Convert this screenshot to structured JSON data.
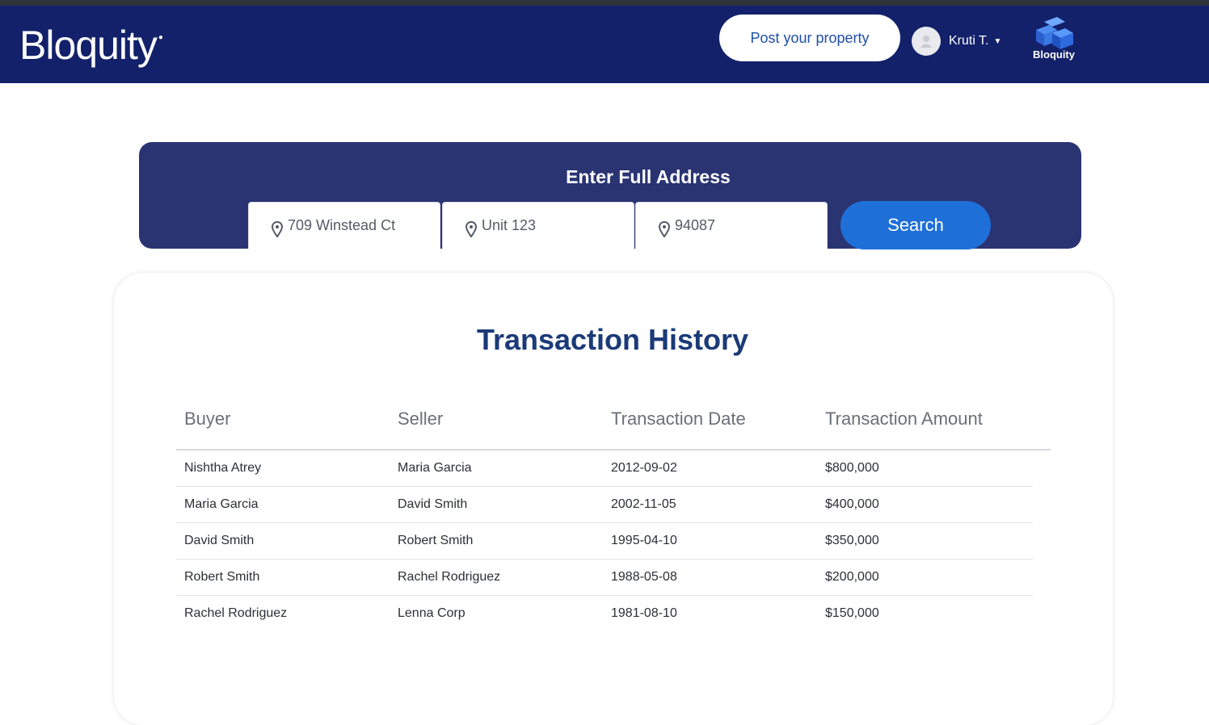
{
  "app": {
    "brand": "Bloquity",
    "logo_caption": "Bloquity"
  },
  "header": {
    "post_label": "Post your property",
    "user_name": "Kruti T.",
    "icons": {
      "avatar": "user-avatar-icon",
      "caret": "caret-down-icon",
      "logo": "bloquity-cube-logo"
    }
  },
  "search": {
    "title": "Enter Full Address",
    "street": "709 Winstead Ct",
    "unit": "Unit 123",
    "zip": "94087",
    "button_label": "Search",
    "field_icon": "location-pin-icon"
  },
  "history": {
    "title": "Transaction History",
    "columns": [
      "Buyer",
      "Seller",
      "Transaction Date",
      "Transaction Amount"
    ],
    "rows": [
      [
        "Nishtha Atrey",
        "Maria Garcia",
        "2012-09-02",
        "$800,000"
      ],
      [
        "Maria Garcia",
        "David Smith",
        "2002-11-05",
        "$400,000"
      ],
      [
        "David Smith",
        "Robert Smith",
        "1995-04-10",
        "$350,000"
      ],
      [
        "Robert Smith",
        "Rachel Rodriguez",
        "1988-05-08",
        "$200,000"
      ],
      [
        "Rachel Rodriguez",
        "Lenna Corp",
        "1981-08-10",
        "$150,000"
      ]
    ]
  },
  "colors": {
    "navbar": "#13216a",
    "panel": "#2a3473",
    "accent": "#1f6fd8",
    "title": "#1b3a78"
  }
}
